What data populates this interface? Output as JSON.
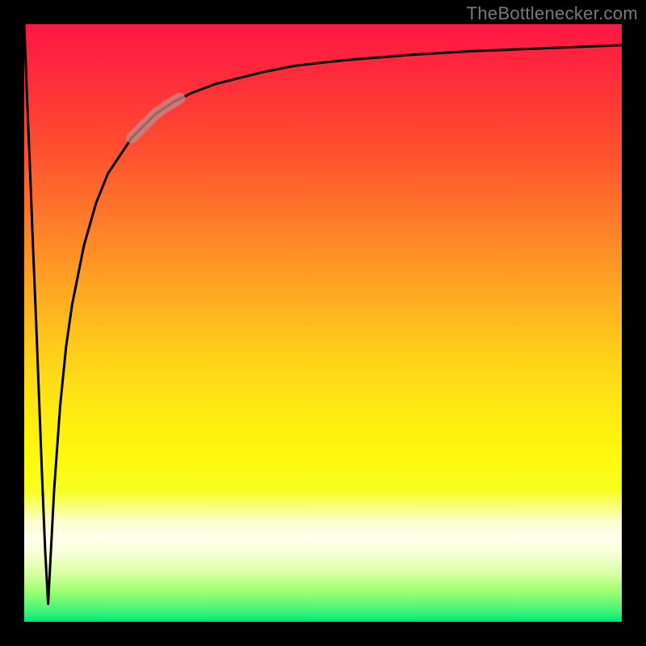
{
  "watermark": "TheBottlenecker.com",
  "colors": {
    "background": "#000000",
    "curve": "#000000",
    "highlight": "#c48a8a",
    "gradient_top": "#ff1744",
    "gradient_bottom": "#00e676"
  },
  "chart_data": {
    "type": "line",
    "title": "",
    "xlabel": "",
    "ylabel": "",
    "xlim": [
      0,
      100
    ],
    "ylim": [
      0,
      100
    ],
    "grid": false,
    "series": [
      {
        "name": "initial-drop",
        "x": [
          0,
          0.5,
          1.0,
          1.5,
          2.0,
          2.5,
          3.0,
          3.5,
          4.0
        ],
        "y": [
          100,
          87,
          75,
          62,
          50,
          37,
          24,
          12,
          3
        ]
      },
      {
        "name": "recovery-curve",
        "x": [
          4.0,
          5,
          6,
          7,
          8,
          9,
          10,
          12,
          14,
          16,
          18,
          20,
          22,
          25,
          28,
          32,
          36,
          40,
          45,
          50,
          55,
          60,
          65,
          70,
          75,
          80,
          85,
          90,
          95,
          100
        ],
        "y": [
          3,
          22,
          36,
          46,
          53,
          58,
          63,
          70,
          75,
          78,
          81,
          83,
          85,
          87,
          88.5,
          90,
          91,
          92,
          93,
          93.6,
          94.1,
          94.5,
          94.9,
          95.2,
          95.5,
          95.7,
          95.9,
          96.1,
          96.3,
          96.5
        ]
      },
      {
        "name": "highlight-segment",
        "x": [
          18,
          19,
          20,
          21,
          22,
          23,
          24,
          25,
          26
        ],
        "y": [
          81,
          82,
          83,
          84,
          85,
          85.7,
          86.4,
          87,
          87.6
        ]
      }
    ],
    "note": "Axes are unlabeled in the source image; values are normalized 0-100 estimates read from the plot geometry. The highlight-segment marks the pale thick overlay on the curve."
  }
}
